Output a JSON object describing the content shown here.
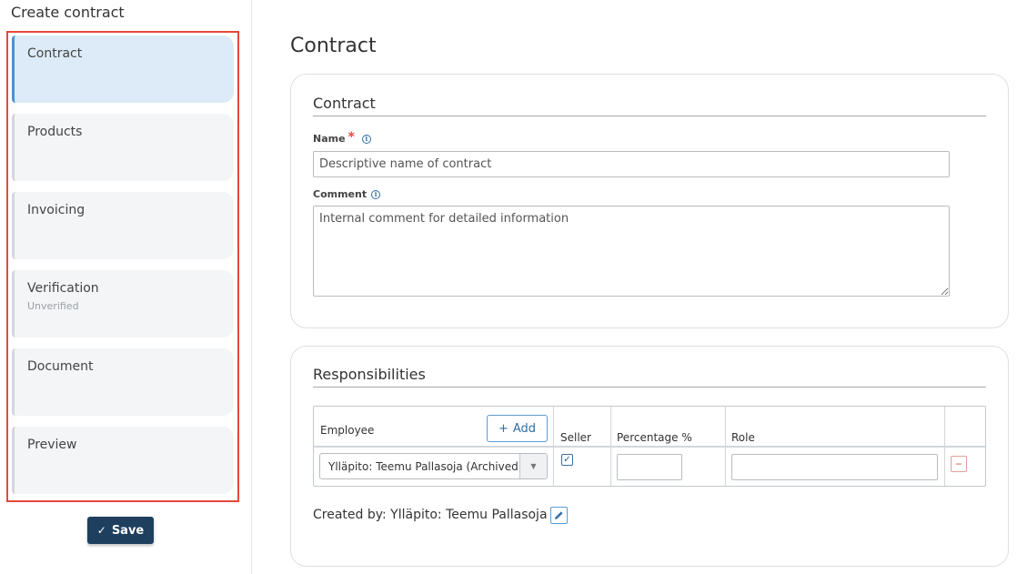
{
  "page": {
    "title": "Create contract"
  },
  "steps": [
    {
      "label": "Contract",
      "sub": "",
      "active": true
    },
    {
      "label": "Products",
      "sub": ""
    },
    {
      "label": "Invoicing",
      "sub": ""
    },
    {
      "label": "Verification",
      "sub": "Unverified"
    },
    {
      "label": "Document",
      "sub": ""
    },
    {
      "label": "Preview",
      "sub": ""
    }
  ],
  "save_button": {
    "label": "Save",
    "icon": "check-icon"
  },
  "main": {
    "title": "Contract"
  },
  "contract_card": {
    "heading": "Contract",
    "name_label": "Name",
    "required_mark": "*",
    "name_placeholder": "Descriptive name of contract",
    "name_value": "",
    "comment_label": "Comment",
    "comment_placeholder": "Internal comment for detailed information",
    "comment_value": ""
  },
  "responsibilities": {
    "heading": "Responsibilities",
    "columns": {
      "employee": "Employee",
      "seller": "Seller",
      "percentage": "Percentage %",
      "role": "Role"
    },
    "add_label": "Add",
    "row": {
      "employee": "Ylläpito: Teemu Pallasoja (Archived)",
      "seller": true,
      "percentage": "",
      "role": ""
    },
    "created_by": "Created by: Ylläpito: Teemu Pallasoja"
  },
  "colors": {
    "accent": "#4a90d0",
    "active_step_bg": "#dcebf7",
    "highlight_border": "#e8473a",
    "save_button_bg": "#1f3f5f",
    "required": "#e8473a",
    "remove": "#d04a3e"
  }
}
